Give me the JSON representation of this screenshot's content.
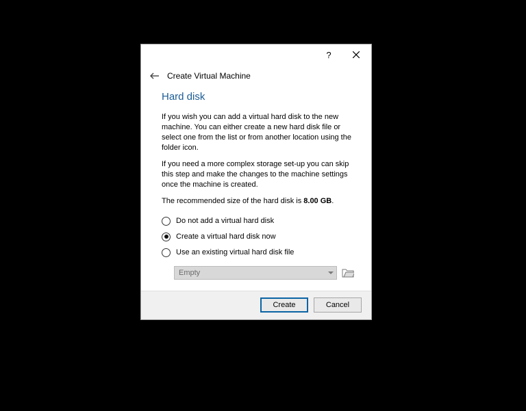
{
  "titlebar": {
    "help_label": "?",
    "close_label": "✕"
  },
  "header": {
    "title": "Create Virtual Machine"
  },
  "section": {
    "heading": "Hard disk",
    "para1": "If you wish you can add a virtual hard disk to the new machine. You can either create a new hard disk file or select one from the list or from another location using the folder icon.",
    "para2": "If you need a more complex storage set-up you can skip this step and make the changes to the machine settings once the machine is created.",
    "rec_prefix": "The recommended size of the hard disk is ",
    "rec_value": "8.00 GB",
    "rec_suffix": "."
  },
  "options": {
    "opt1": "Do not add a virtual hard disk",
    "opt2": "Create a virtual hard disk now",
    "opt3": "Use an existing virtual hard disk file",
    "selected": "opt2",
    "dropdown_value": "Empty"
  },
  "buttons": {
    "create": "Create",
    "cancel": "Cancel"
  }
}
